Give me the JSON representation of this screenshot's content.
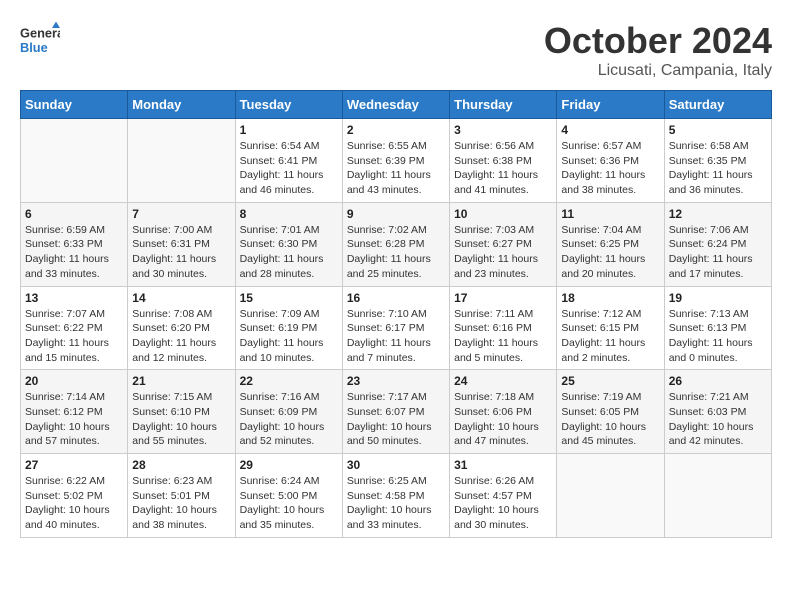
{
  "header": {
    "logo_line1": "General",
    "logo_line2": "Blue",
    "month": "October 2024",
    "location": "Licusati, Campania, Italy"
  },
  "weekdays": [
    "Sunday",
    "Monday",
    "Tuesday",
    "Wednesday",
    "Thursday",
    "Friday",
    "Saturday"
  ],
  "weeks": [
    [
      {
        "day": "",
        "sunrise": "",
        "sunset": "",
        "daylight": ""
      },
      {
        "day": "",
        "sunrise": "",
        "sunset": "",
        "daylight": ""
      },
      {
        "day": "1",
        "sunrise": "Sunrise: 6:54 AM",
        "sunset": "Sunset: 6:41 PM",
        "daylight": "Daylight: 11 hours and 46 minutes."
      },
      {
        "day": "2",
        "sunrise": "Sunrise: 6:55 AM",
        "sunset": "Sunset: 6:39 PM",
        "daylight": "Daylight: 11 hours and 43 minutes."
      },
      {
        "day": "3",
        "sunrise": "Sunrise: 6:56 AM",
        "sunset": "Sunset: 6:38 PM",
        "daylight": "Daylight: 11 hours and 41 minutes."
      },
      {
        "day": "4",
        "sunrise": "Sunrise: 6:57 AM",
        "sunset": "Sunset: 6:36 PM",
        "daylight": "Daylight: 11 hours and 38 minutes."
      },
      {
        "day": "5",
        "sunrise": "Sunrise: 6:58 AM",
        "sunset": "Sunset: 6:35 PM",
        "daylight": "Daylight: 11 hours and 36 minutes."
      }
    ],
    [
      {
        "day": "6",
        "sunrise": "Sunrise: 6:59 AM",
        "sunset": "Sunset: 6:33 PM",
        "daylight": "Daylight: 11 hours and 33 minutes."
      },
      {
        "day": "7",
        "sunrise": "Sunrise: 7:00 AM",
        "sunset": "Sunset: 6:31 PM",
        "daylight": "Daylight: 11 hours and 30 minutes."
      },
      {
        "day": "8",
        "sunrise": "Sunrise: 7:01 AM",
        "sunset": "Sunset: 6:30 PM",
        "daylight": "Daylight: 11 hours and 28 minutes."
      },
      {
        "day": "9",
        "sunrise": "Sunrise: 7:02 AM",
        "sunset": "Sunset: 6:28 PM",
        "daylight": "Daylight: 11 hours and 25 minutes."
      },
      {
        "day": "10",
        "sunrise": "Sunrise: 7:03 AM",
        "sunset": "Sunset: 6:27 PM",
        "daylight": "Daylight: 11 hours and 23 minutes."
      },
      {
        "day": "11",
        "sunrise": "Sunrise: 7:04 AM",
        "sunset": "Sunset: 6:25 PM",
        "daylight": "Daylight: 11 hours and 20 minutes."
      },
      {
        "day": "12",
        "sunrise": "Sunrise: 7:06 AM",
        "sunset": "Sunset: 6:24 PM",
        "daylight": "Daylight: 11 hours and 17 minutes."
      }
    ],
    [
      {
        "day": "13",
        "sunrise": "Sunrise: 7:07 AM",
        "sunset": "Sunset: 6:22 PM",
        "daylight": "Daylight: 11 hours and 15 minutes."
      },
      {
        "day": "14",
        "sunrise": "Sunrise: 7:08 AM",
        "sunset": "Sunset: 6:20 PM",
        "daylight": "Daylight: 11 hours and 12 minutes."
      },
      {
        "day": "15",
        "sunrise": "Sunrise: 7:09 AM",
        "sunset": "Sunset: 6:19 PM",
        "daylight": "Daylight: 11 hours and 10 minutes."
      },
      {
        "day": "16",
        "sunrise": "Sunrise: 7:10 AM",
        "sunset": "Sunset: 6:17 PM",
        "daylight": "Daylight: 11 hours and 7 minutes."
      },
      {
        "day": "17",
        "sunrise": "Sunrise: 7:11 AM",
        "sunset": "Sunset: 6:16 PM",
        "daylight": "Daylight: 11 hours and 5 minutes."
      },
      {
        "day": "18",
        "sunrise": "Sunrise: 7:12 AM",
        "sunset": "Sunset: 6:15 PM",
        "daylight": "Daylight: 11 hours and 2 minutes."
      },
      {
        "day": "19",
        "sunrise": "Sunrise: 7:13 AM",
        "sunset": "Sunset: 6:13 PM",
        "daylight": "Daylight: 11 hours and 0 minutes."
      }
    ],
    [
      {
        "day": "20",
        "sunrise": "Sunrise: 7:14 AM",
        "sunset": "Sunset: 6:12 PM",
        "daylight": "Daylight: 10 hours and 57 minutes."
      },
      {
        "day": "21",
        "sunrise": "Sunrise: 7:15 AM",
        "sunset": "Sunset: 6:10 PM",
        "daylight": "Daylight: 10 hours and 55 minutes."
      },
      {
        "day": "22",
        "sunrise": "Sunrise: 7:16 AM",
        "sunset": "Sunset: 6:09 PM",
        "daylight": "Daylight: 10 hours and 52 minutes."
      },
      {
        "day": "23",
        "sunrise": "Sunrise: 7:17 AM",
        "sunset": "Sunset: 6:07 PM",
        "daylight": "Daylight: 10 hours and 50 minutes."
      },
      {
        "day": "24",
        "sunrise": "Sunrise: 7:18 AM",
        "sunset": "Sunset: 6:06 PM",
        "daylight": "Daylight: 10 hours and 47 minutes."
      },
      {
        "day": "25",
        "sunrise": "Sunrise: 7:19 AM",
        "sunset": "Sunset: 6:05 PM",
        "daylight": "Daylight: 10 hours and 45 minutes."
      },
      {
        "day": "26",
        "sunrise": "Sunrise: 7:21 AM",
        "sunset": "Sunset: 6:03 PM",
        "daylight": "Daylight: 10 hours and 42 minutes."
      }
    ],
    [
      {
        "day": "27",
        "sunrise": "Sunrise: 6:22 AM",
        "sunset": "Sunset: 5:02 PM",
        "daylight": "Daylight: 10 hours and 40 minutes."
      },
      {
        "day": "28",
        "sunrise": "Sunrise: 6:23 AM",
        "sunset": "Sunset: 5:01 PM",
        "daylight": "Daylight: 10 hours and 38 minutes."
      },
      {
        "day": "29",
        "sunrise": "Sunrise: 6:24 AM",
        "sunset": "Sunset: 5:00 PM",
        "daylight": "Daylight: 10 hours and 35 minutes."
      },
      {
        "day": "30",
        "sunrise": "Sunrise: 6:25 AM",
        "sunset": "Sunset: 4:58 PM",
        "daylight": "Daylight: 10 hours and 33 minutes."
      },
      {
        "day": "31",
        "sunrise": "Sunrise: 6:26 AM",
        "sunset": "Sunset: 4:57 PM",
        "daylight": "Daylight: 10 hours and 30 minutes."
      },
      {
        "day": "",
        "sunrise": "",
        "sunset": "",
        "daylight": ""
      },
      {
        "day": "",
        "sunrise": "",
        "sunset": "",
        "daylight": ""
      }
    ]
  ]
}
